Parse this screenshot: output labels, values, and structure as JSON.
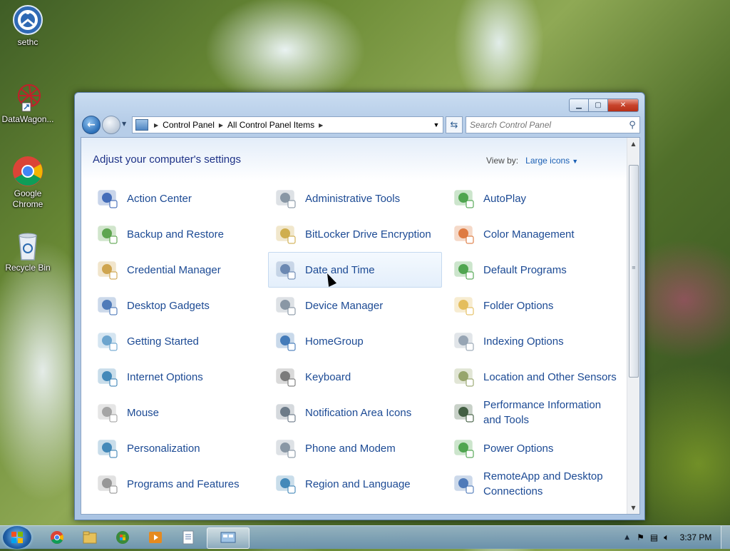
{
  "desktop": {
    "icons": [
      {
        "label": "sethc",
        "icon": "ease-of-access-icon"
      },
      {
        "label": "DataWagon...",
        "icon": "datawagon-icon"
      },
      {
        "label": "Google Chrome",
        "icon": "chrome-icon"
      },
      {
        "label": "Recycle Bin",
        "icon": "recycle-bin-icon"
      }
    ]
  },
  "window": {
    "breadcrumbs": [
      "Control Panel",
      "All Control Panel Items"
    ],
    "search_placeholder": "Search Control Panel",
    "heading": "Adjust your computer's settings",
    "view_by_label": "View by:",
    "view_by_value": "Large icons",
    "items": [
      {
        "label": "Action Center",
        "icon": "flag-icon",
        "color": "#2d5bb0"
      },
      {
        "label": "Administrative Tools",
        "icon": "admin-tools-icon",
        "color": "#7a8a9a"
      },
      {
        "label": "AutoPlay",
        "icon": "autoplay-icon",
        "color": "#3a9a3a"
      },
      {
        "label": "Backup and Restore",
        "icon": "backup-icon",
        "color": "#4a9a3a"
      },
      {
        "label": "BitLocker Drive Encryption",
        "icon": "key-icon",
        "color": "#c9a338"
      },
      {
        "label": "Color Management",
        "icon": "color-icon",
        "color": "#d96a2a"
      },
      {
        "label": "Credential Manager",
        "icon": "vault-icon",
        "color": "#c99a38"
      },
      {
        "label": "Date and Time",
        "icon": "calendar-clock-icon",
        "color": "#5a7aa8"
      },
      {
        "label": "Default Programs",
        "icon": "default-programs-icon",
        "color": "#3a9a3a"
      },
      {
        "label": "Desktop Gadgets",
        "icon": "gadgets-icon",
        "color": "#3a6ab0"
      },
      {
        "label": "Device Manager",
        "icon": "device-manager-icon",
        "color": "#7a8a9a"
      },
      {
        "label": "Folder Options",
        "icon": "folder-icon",
        "color": "#e0b64a"
      },
      {
        "label": "Getting Started",
        "icon": "getting-started-icon",
        "color": "#5a9ac8"
      },
      {
        "label": "HomeGroup",
        "icon": "homegroup-icon",
        "color": "#2d6ab0"
      },
      {
        "label": "Indexing Options",
        "icon": "indexing-icon",
        "color": "#8a9aaa"
      },
      {
        "label": "Internet Options",
        "icon": "internet-icon",
        "color": "#2d7ab0"
      },
      {
        "label": "Keyboard",
        "icon": "keyboard-icon",
        "color": "#6a6a6a"
      },
      {
        "label": "Location and Other Sensors",
        "icon": "sensor-icon",
        "color": "#8a9a5a"
      },
      {
        "label": "Mouse",
        "icon": "mouse-icon",
        "color": "#9a9a9a"
      },
      {
        "label": "Notification Area Icons",
        "icon": "notification-icon",
        "color": "#5a6a7a"
      },
      {
        "label": "Performance Information and Tools",
        "icon": "performance-icon",
        "color": "#2a4a2a"
      },
      {
        "label": "Personalization",
        "icon": "personalization-icon",
        "color": "#2d7ab0"
      },
      {
        "label": "Phone and Modem",
        "icon": "phone-icon",
        "color": "#7a8a9a"
      },
      {
        "label": "Power Options",
        "icon": "battery-icon",
        "color": "#3a9a3a"
      },
      {
        "label": "Programs and Features",
        "icon": "programs-icon",
        "color": "#8a8a8a"
      },
      {
        "label": "Region and Language",
        "icon": "globe-clock-icon",
        "color": "#2d7ab0"
      },
      {
        "label": "RemoteApp and Desktop Connections",
        "icon": "remoteapp-icon",
        "color": "#3a6ab0"
      }
    ]
  },
  "taskbar": {
    "clock": "3:37 PM",
    "apps": [
      "chrome-icon",
      "explorer-icon",
      "media-center-icon",
      "media-player-icon",
      "notepad-icon",
      "control-panel-icon"
    ]
  }
}
